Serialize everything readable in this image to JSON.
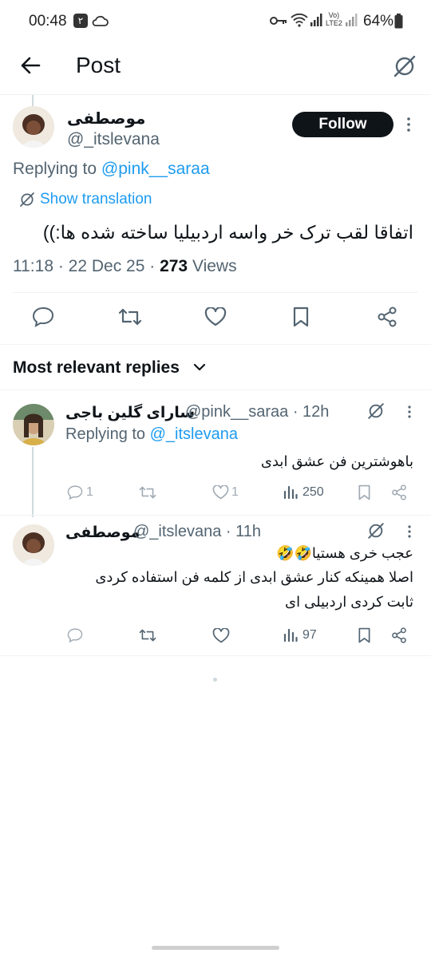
{
  "status_bar": {
    "time": "00:48",
    "badge": "۲",
    "battery": "64%"
  },
  "header": {
    "title": "Post"
  },
  "post": {
    "author_name": "موصطفی",
    "author_handle": "@_itslevana",
    "follow_label": "Follow",
    "replying_prefix": "Replying to ",
    "replying_handle": "@pink__saraa",
    "show_translation": "Show translation",
    "text": "اتفاقا لقب ترک خر واسه اردبیلیا ساخته شده ها:))",
    "time": "11:18 · 22 Dec 25 · ",
    "views_count": "273",
    "views_label": " Views"
  },
  "replies_section": {
    "title": "Most relevant replies"
  },
  "replies": [
    {
      "name": "سارای گلین باجی",
      "handle": "@pink__saraa · 12h",
      "replying_prefix": "Replying to ",
      "replying_handle": "@_itslevana",
      "text": "باهوشترین فن عشق ابدی",
      "reply_count": "1",
      "like_count": "1",
      "view_count": "250"
    },
    {
      "name": "موصطفی",
      "handle": "@_itslevana · 11h",
      "text_line1": "عجب خری هستیا🤣🤣",
      "text_line2": "اصلا همینکه کنار عشق ابدی از کلمه فن استفاده کردی",
      "text_line3": "ثابت کردی اردبیلی ای",
      "view_count": "97"
    }
  ],
  "colors": {
    "accent": "#1d9bf0",
    "text": "#0f1419",
    "secondary": "#536471",
    "border": "#eff3f4"
  }
}
